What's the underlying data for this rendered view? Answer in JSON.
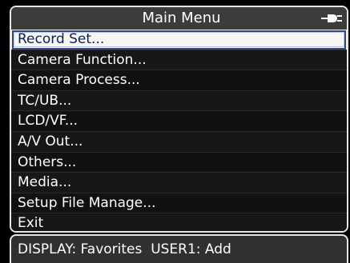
{
  "menu": {
    "title": "Main Menu",
    "power_icon": "dc-plug-icon",
    "items": [
      {
        "label": "Record Set...",
        "selected": true
      },
      {
        "label": "Camera Function..."
      },
      {
        "label": "Camera Process..."
      },
      {
        "label": "TC/UB..."
      },
      {
        "label": "LCD/VF..."
      },
      {
        "label": "A/V Out..."
      },
      {
        "label": "Others..."
      },
      {
        "label": "Media..."
      },
      {
        "label": "Setup File Manage..."
      },
      {
        "label": "Exit"
      }
    ]
  },
  "status_bar": {
    "display_hint": "DISPLAY: Favorites",
    "user1_hint": "USER1: Add"
  },
  "colors": {
    "selected_bg": "#f6f6f6",
    "selected_text": "#0c1f57",
    "title_bg": "#3c3c3c",
    "frame": "#e6e6e6"
  }
}
